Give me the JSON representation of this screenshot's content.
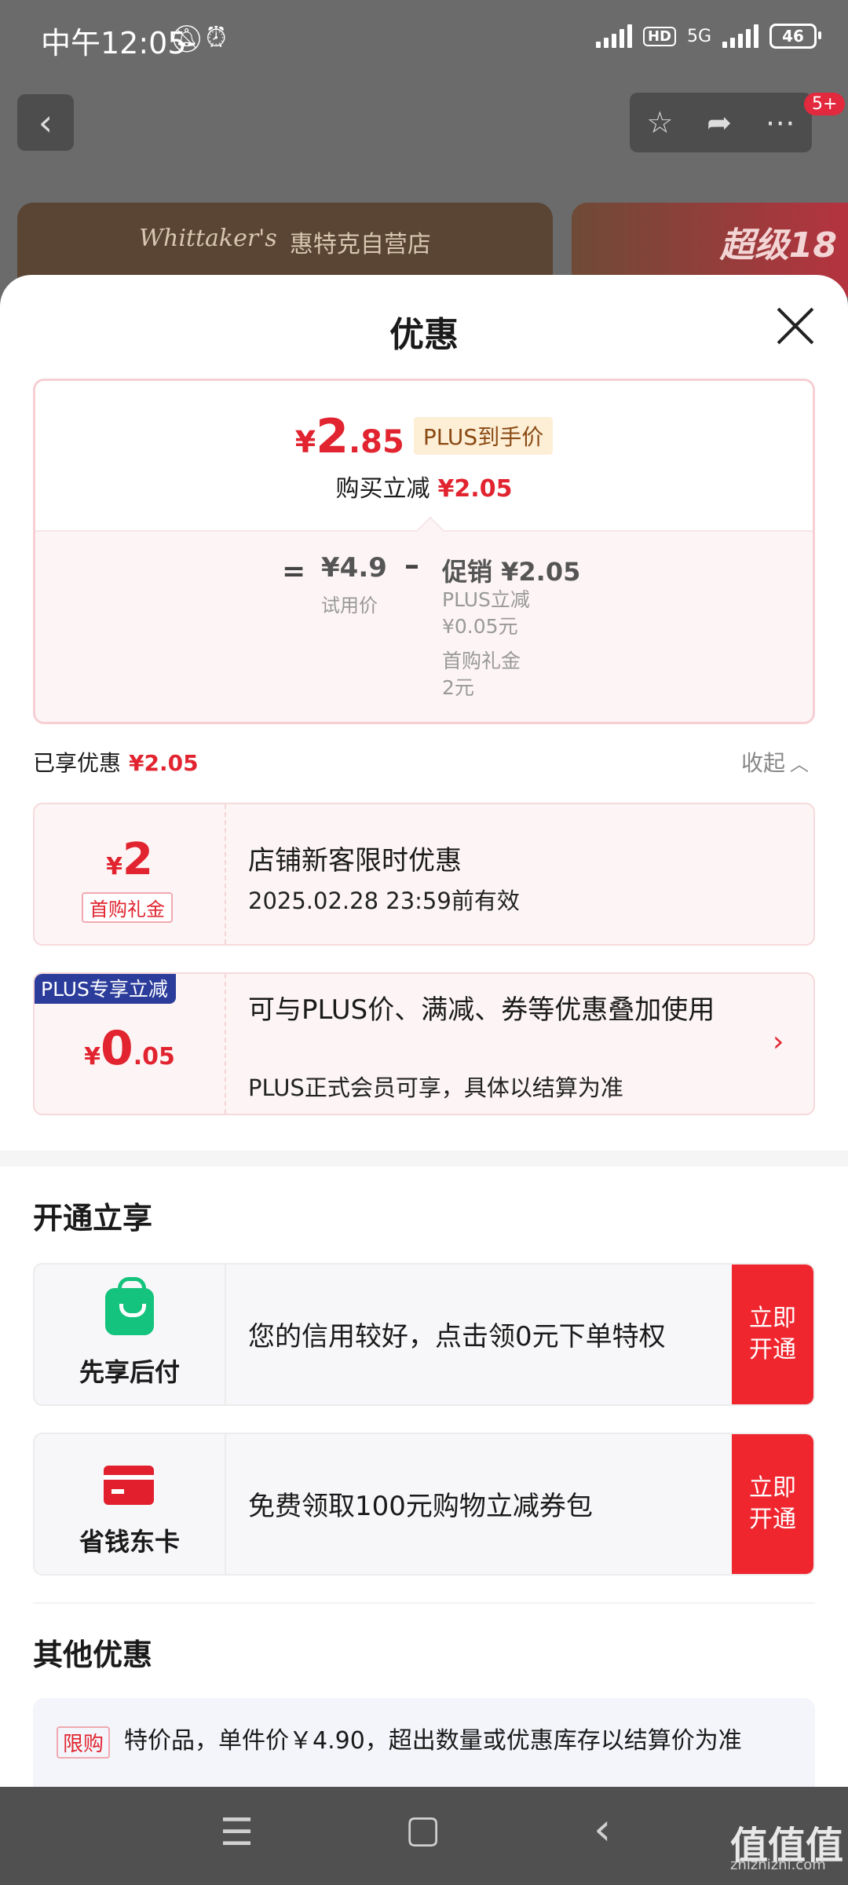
{
  "status": {
    "time": "中午12:05",
    "hd": "HD",
    "network": "5G",
    "battery": "46"
  },
  "topbar": {
    "back_icon": "‹",
    "fav_icon": "☆",
    "share_icon": "➦",
    "more_icon": "⋯",
    "badge": "5+"
  },
  "banner": {
    "brand": "Whittaker's",
    "store": "惠特克自营店",
    "promo": "超级18"
  },
  "sheet": {
    "title": "优惠",
    "price": {
      "symbol": "¥",
      "integer": "2",
      "decimal": ".85",
      "tag": "PLUS到手价"
    },
    "reduce": {
      "label": "购买立减",
      "value": "¥2.05"
    },
    "breakdown": {
      "eq": "=",
      "trial_price": "¥4.9",
      "trial_label": "试用价",
      "minus": "–",
      "promo": "促销 ¥2.05",
      "details": [
        "PLUS立减",
        "¥0.05元",
        "首购礼金",
        "2元"
      ]
    },
    "enjoyed": {
      "label": "已享优惠",
      "value": "¥2.05",
      "collapse": "收起"
    },
    "coupons": [
      {
        "symbol": "¥",
        "amount": "2",
        "decimal": "",
        "tag": "首购礼金",
        "title": "店铺新客限时优惠",
        "sub": "2025.02.28 23:59前有效"
      },
      {
        "flag": "PLUS专享立减",
        "symbol": "¥",
        "amount": "0",
        "decimal": ".05",
        "title": "可与PLUS价、满减、券等优惠叠加使用",
        "sub": "PLUS正式会员可享，具体以结算为准",
        "arrow": "›"
      }
    ],
    "open_section": {
      "title": "开通立享",
      "items": [
        {
          "name": "先享后付",
          "text": "您的信用较好，点击领0元下单特权",
          "button": "立即开通"
        },
        {
          "name": "省钱东卡",
          "text": "免费领取100元购物立减券包",
          "button": "立即开通"
        }
      ]
    },
    "other_section": {
      "title": "其他优惠",
      "tag": "限购",
      "text": "特价品，单件价￥4.90，超出数量或优惠库存以结算价为准"
    }
  },
  "navbar": {
    "menu_icon": "☰",
    "home_icon": "▢",
    "back_icon": "‹"
  },
  "watermark": {
    "brand": "值值值",
    "url": "zhizhizhi.com"
  }
}
